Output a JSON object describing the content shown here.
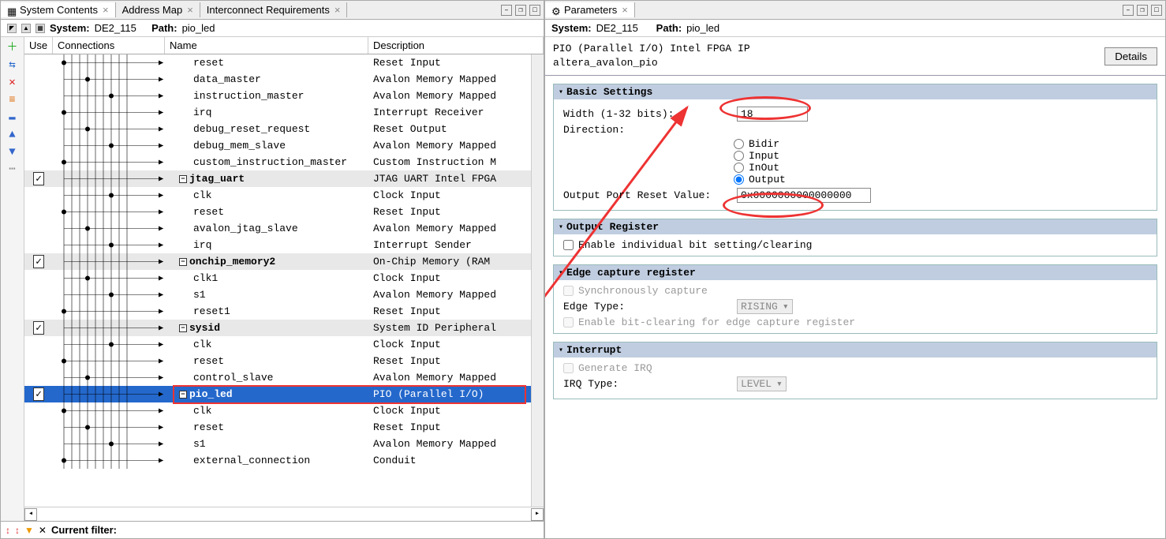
{
  "tabs_left": [
    {
      "label": "System Contents",
      "active": true
    },
    {
      "label": "Address Map",
      "active": false
    },
    {
      "label": "Interconnect Requirements",
      "active": false
    }
  ],
  "tabs_right": [
    {
      "label": "Parameters",
      "active": true
    }
  ],
  "left_path": {
    "system_lbl": "System:",
    "system": "DE2_115",
    "path_lbl": "Path:",
    "path": "pio_led"
  },
  "right_path": {
    "system_lbl": "System:",
    "system": "DE2_115",
    "path_lbl": "Path:",
    "path": "pio_led"
  },
  "headers": {
    "use": "Use",
    "conn": "Connections",
    "name": "Name",
    "desc": "Description"
  },
  "rows": [
    {
      "indent": 2,
      "name": "reset",
      "desc": "Reset Input"
    },
    {
      "indent": 2,
      "name": "data_master",
      "desc": "Avalon Memory Mapped"
    },
    {
      "indent": 2,
      "name": "instruction_master",
      "desc": "Avalon Memory Mapped"
    },
    {
      "indent": 2,
      "name": "irq",
      "desc": "Interrupt Receiver"
    },
    {
      "indent": 2,
      "name": "debug_reset_request",
      "desc": "Reset Output"
    },
    {
      "indent": 2,
      "name": "debug_mem_slave",
      "desc": "Avalon Memory Mapped"
    },
    {
      "indent": 2,
      "name": "custom_instruction_master",
      "desc": "Custom Instruction M"
    },
    {
      "hdr": true,
      "use": true,
      "indent": 1,
      "expand": true,
      "name": "jtag_uart",
      "desc": "JTAG UART Intel FPGA"
    },
    {
      "indent": 2,
      "name": "clk",
      "desc": "Clock Input"
    },
    {
      "indent": 2,
      "name": "reset",
      "desc": "Reset Input"
    },
    {
      "indent": 2,
      "name": "avalon_jtag_slave",
      "desc": "Avalon Memory Mapped"
    },
    {
      "indent": 2,
      "name": "irq",
      "desc": "Interrupt Sender"
    },
    {
      "hdr": true,
      "use": true,
      "indent": 1,
      "expand": true,
      "name": "onchip_memory2",
      "desc": "On-Chip Memory (RAM"
    },
    {
      "indent": 2,
      "name": "clk1",
      "desc": "Clock Input"
    },
    {
      "indent": 2,
      "name": "s1",
      "desc": "Avalon Memory Mapped"
    },
    {
      "indent": 2,
      "name": "reset1",
      "desc": "Reset Input"
    },
    {
      "hdr": true,
      "use": true,
      "indent": 1,
      "expand": true,
      "name": "sysid",
      "desc": "System ID Peripheral"
    },
    {
      "indent": 2,
      "name": "clk",
      "desc": "Clock Input"
    },
    {
      "indent": 2,
      "name": "reset",
      "desc": "Reset Input"
    },
    {
      "indent": 2,
      "name": "control_slave",
      "desc": "Avalon Memory Mapped"
    },
    {
      "hdr": true,
      "sel": true,
      "use": true,
      "indent": 1,
      "expand": true,
      "name": "pio_led",
      "desc": "PIO (Parallel I/O)"
    },
    {
      "indent": 2,
      "name": "clk",
      "desc": "Clock Input"
    },
    {
      "indent": 2,
      "name": "reset",
      "desc": "Reset Input"
    },
    {
      "indent": 2,
      "name": "s1",
      "desc": "Avalon Memory Mapped"
    },
    {
      "indent": 2,
      "name": "external_connection",
      "desc": "Conduit"
    }
  ],
  "filter": {
    "label": "Current filter:"
  },
  "ipinfo": {
    "title": "PIO (Parallel I/O) Intel FPGA IP",
    "sub": "altera_avalon_pio",
    "details": "Details"
  },
  "groups": {
    "basic": {
      "title": "Basic Settings",
      "width_lbl": "Width (1-32 bits):",
      "width_val": "18",
      "dir_lbl": "Direction:",
      "dir_opts": [
        "Bidir",
        "Input",
        "InOut",
        "Output"
      ],
      "dir_sel": "Output",
      "reset_lbl": "Output Port Reset Value:",
      "reset_val": "0x0000000000000000"
    },
    "outreg": {
      "title": "Output Register",
      "chk": "Enable individual bit setting/clearing"
    },
    "edge": {
      "title": "Edge capture register",
      "sync": "Synchronously capture",
      "type_lbl": "Edge Type:",
      "type_val": "RISING",
      "bitclr": "Enable bit-clearing for edge capture register"
    },
    "intr": {
      "title": "Interrupt",
      "gen": "Generate IRQ",
      "type_lbl": "IRQ Type:",
      "type_val": "LEVEL"
    }
  }
}
